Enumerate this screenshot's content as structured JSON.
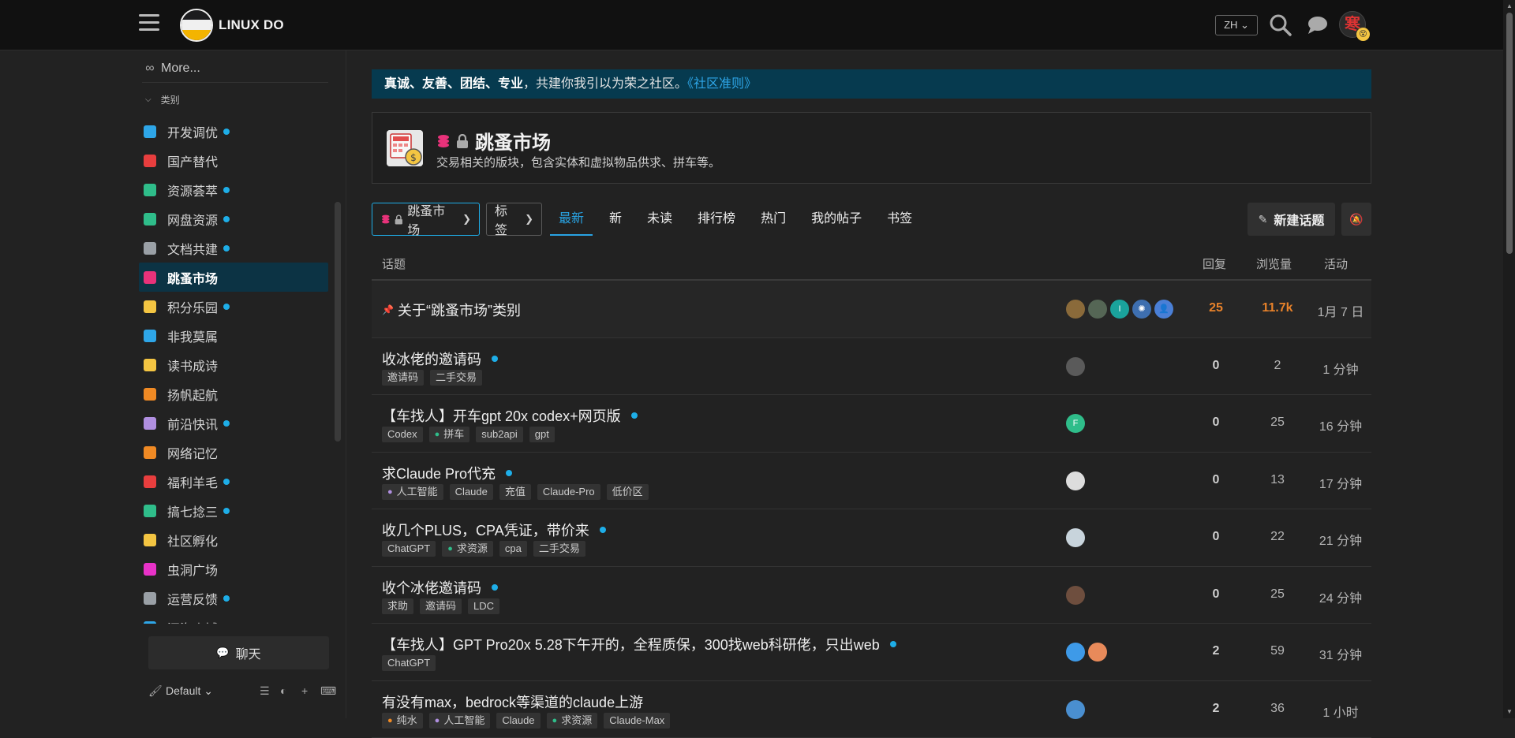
{
  "header": {
    "site_name": "LINUX DO",
    "lang": "ZH",
    "avatar_char": "寒"
  },
  "sidebar": {
    "more_label": "More...",
    "categories_header": "类别",
    "items": [
      {
        "label": "开发调优",
        "icon": "code-icon",
        "color": "#2ea6e8",
        "dot": true
      },
      {
        "label": "国产替代",
        "icon": "sprout-icon",
        "color": "#e83e3e",
        "dot": false
      },
      {
        "label": "资源荟萃",
        "icon": "share-icon",
        "color": "#2fbd8a",
        "dot": true
      },
      {
        "label": "网盘资源",
        "icon": "drive-icon",
        "color": "#2fbd8a",
        "dot": true
      },
      {
        "label": "文档共建",
        "icon": "book-icon",
        "color": "#9aa0a6",
        "dot": true
      },
      {
        "label": "跳蚤市场",
        "icon": "coins-icon",
        "color": "#e8327a",
        "dot": false,
        "active": true
      },
      {
        "label": "积分乐园",
        "icon": "card-icon",
        "color": "#f4c542",
        "dot": true
      },
      {
        "label": "非我莫属",
        "icon": "briefcase-icon",
        "color": "#2ea6e8",
        "dot": false
      },
      {
        "label": "读书成诗",
        "icon": "reader-icon",
        "color": "#f4c542",
        "dot": false
      },
      {
        "label": "扬帆起航",
        "icon": "rocket-icon",
        "color": "#f08a24",
        "dot": false
      },
      {
        "label": "前沿快讯",
        "icon": "newspaper-icon",
        "color": "#b08fe0",
        "dot": true
      },
      {
        "label": "网络记忆",
        "icon": "rss-icon",
        "color": "#f08a24",
        "dot": false
      },
      {
        "label": "福利羊毛",
        "icon": "piggy-icon",
        "color": "#e83e3e",
        "dot": true
      },
      {
        "label": "搞七捻三",
        "icon": "drop-icon",
        "color": "#2fbd8a",
        "dot": true
      },
      {
        "label": "社区孵化",
        "icon": "bulb-icon",
        "color": "#f4c542",
        "dot": false
      },
      {
        "label": "虫洞广场",
        "icon": "wormhole-icon",
        "color": "#e832c8",
        "dot": false
      },
      {
        "label": "运营反馈",
        "icon": "comments-icon",
        "color": "#9aa0a6",
        "dot": true
      },
      {
        "label": "深海幽域",
        "icon": "wave-icon",
        "color": "#2ea6e8",
        "dot": false
      }
    ],
    "chat_label": "聊天",
    "theme_label": "Default"
  },
  "banner": {
    "bold": "真诚、友善、团结、专业",
    "text": "，共建你我引以为荣之社区。",
    "link": "《社区准则》"
  },
  "category": {
    "title": "跳蚤市场",
    "description": "交易相关的版块，包含实体和虚拟物品供求、拼车等。"
  },
  "nav": {
    "crumb_category": "跳蚤市场",
    "crumb_tags": "标签",
    "tabs": [
      "最新",
      "新",
      "未读",
      "排行榜",
      "热门",
      "我的帖子",
      "书签"
    ],
    "active_tab": "最新",
    "new_topic": "新建话题"
  },
  "table": {
    "headers": {
      "topic": "话题",
      "replies": "回复",
      "views": "浏览量",
      "activity": "活动"
    },
    "rows": [
      {
        "title": "关于“跳蚤市场”类别",
        "pinned": true,
        "unread": false,
        "tags": [],
        "replies": "25",
        "views": "11.7k",
        "activity": "1月 7 日",
        "hot": true,
        "posters": [
          {
            "bg": "#8a6a3a",
            "ch": ""
          },
          {
            "bg": "#556655",
            "ch": ""
          },
          {
            "bg": "#1aa39c",
            "ch": "I"
          },
          {
            "bg": "#3e6fb0",
            "ch": "✺"
          },
          {
            "bg": "#4a7fd6",
            "ch": "👤"
          }
        ]
      },
      {
        "title": "收冰佬的邀请码",
        "pinned": false,
        "unread": true,
        "tags": [
          {
            "label": "邀请码"
          },
          {
            "label": "二手交易"
          }
        ],
        "replies": "0",
        "views": "2",
        "activity": "1 分钟",
        "posters": [
          {
            "bg": "#5a5a5a",
            "ch": ""
          }
        ]
      },
      {
        "title": "【车找人】开车gpt 20x codex+网页版",
        "pinned": false,
        "unread": true,
        "tags": [
          {
            "label": "Codex"
          },
          {
            "label": "拼车",
            "icon": "car-icon",
            "icolor": "#2fbd8a"
          },
          {
            "label": "sub2api"
          },
          {
            "label": "gpt"
          }
        ],
        "replies": "0",
        "views": "25",
        "activity": "16 分钟",
        "posters": [
          {
            "bg": "#2fbd8a",
            "ch": "F"
          }
        ]
      },
      {
        "title": "求Claude Pro代充",
        "pinned": false,
        "unread": true,
        "tags": [
          {
            "label": "人工智能",
            "icon": "brain-icon",
            "icolor": "#b08fe0"
          },
          {
            "label": "Claude"
          },
          {
            "label": "充值"
          },
          {
            "label": "Claude-Pro"
          },
          {
            "label": "低价区"
          }
        ],
        "replies": "0",
        "views": "13",
        "activity": "17 分钟",
        "posters": [
          {
            "bg": "#dddddd",
            "ch": ""
          }
        ]
      },
      {
        "title": "收几个PLUS，CPA凭证，带价来",
        "pinned": false,
        "unread": true,
        "tags": [
          {
            "label": "ChatGPT"
          },
          {
            "label": "求资源",
            "icon": "recycle-icon",
            "icolor": "#2fbd8a"
          },
          {
            "label": "cpa"
          },
          {
            "label": "二手交易"
          }
        ],
        "replies": "0",
        "views": "22",
        "activity": "21 分钟",
        "posters": [
          {
            "bg": "#c8d4dc",
            "ch": ""
          }
        ]
      },
      {
        "title": "收个冰佬邀请码",
        "pinned": false,
        "unread": true,
        "tags": [
          {
            "label": "求助"
          },
          {
            "label": "邀请码"
          },
          {
            "label": "LDC"
          }
        ],
        "replies": "0",
        "views": "25",
        "activity": "24 分钟",
        "posters": [
          {
            "bg": "#6e4e3e",
            "ch": ""
          }
        ]
      },
      {
        "title": "【车找人】GPT Pro20x 5.28下午开的，全程质保，300找web科研佬，只出web",
        "pinned": false,
        "unread": true,
        "tags": [
          {
            "label": "ChatGPT"
          }
        ],
        "replies": "2",
        "views": "59",
        "activity": "31 分钟",
        "posters": [
          {
            "bg": "#3e9ae8",
            "ch": ""
          },
          {
            "bg": "#e88a5a",
            "ch": ""
          }
        ]
      },
      {
        "title": "有没有max，bedrock等渠道的claude上游",
        "pinned": false,
        "unread": false,
        "tags": [
          {
            "label": "纯水",
            "icon": "water-icon",
            "icolor": "#f08a24"
          },
          {
            "label": "人工智能",
            "icon": "brain-icon",
            "icolor": "#b08fe0"
          },
          {
            "label": "Claude"
          },
          {
            "label": "求资源",
            "icon": "recycle-icon",
            "icolor": "#2fbd8a"
          },
          {
            "label": "Claude-Max"
          }
        ],
        "replies": "2",
        "views": "36",
        "activity": "1 小时",
        "posters": [
          {
            "bg": "#4a8fd0",
            "ch": ""
          }
        ]
      }
    ]
  }
}
